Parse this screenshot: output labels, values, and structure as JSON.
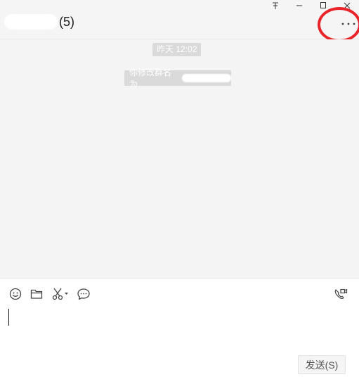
{
  "header": {
    "title_count": "(5)",
    "more_label": "···"
  },
  "window_controls": {
    "pin_icon": "pin-icon",
    "minimize_icon": "minimize-icon",
    "maximize_icon": "maximize-icon",
    "close_icon": "close-icon"
  },
  "chat": {
    "timestamp": "昨天 12:02",
    "system_notice": "你修改群名为"
  },
  "toolbar": {
    "icons": [
      "emoji-icon",
      "folder-icon",
      "screenshot-scissors-icon",
      "chat-history-icon",
      "video-call-icon"
    ]
  },
  "composer": {
    "send_label": "发送(S)"
  },
  "colors": {
    "header_bg": "#f5f5f5",
    "chat_bg": "#f4f4f4",
    "pill_bg": "#dadada",
    "highlight_ring": "#e8232a"
  }
}
